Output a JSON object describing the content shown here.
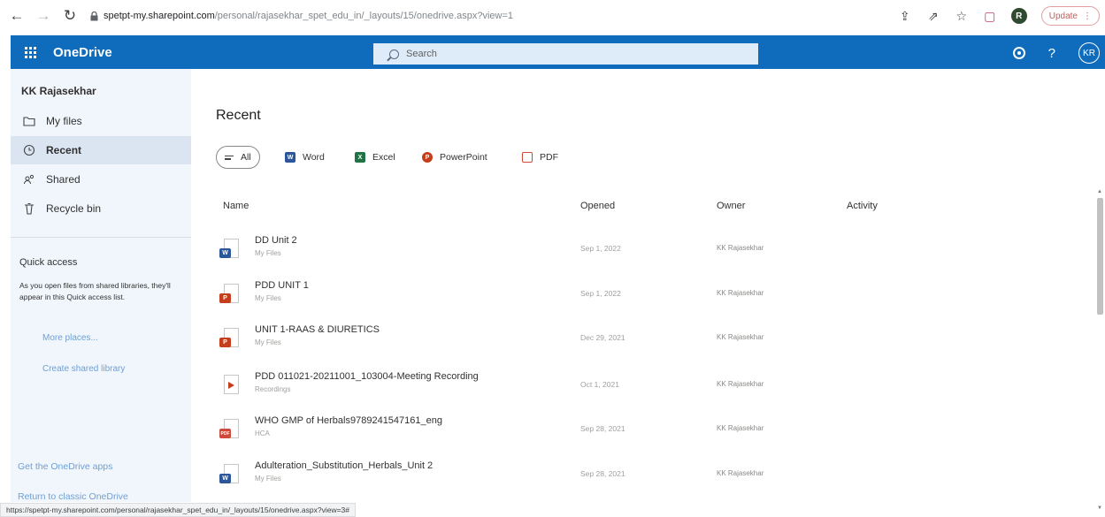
{
  "browser": {
    "url_host": "spetpt-my.sharepoint.com",
    "url_path": "/personal/rajasekhar_spet_edu_in/_layouts/15/onedrive.aspx?view=1",
    "update_label": "Update",
    "profile_initial": "R"
  },
  "suite": {
    "app_name": "OneDrive",
    "search_placeholder": "Search",
    "avatar_initials": "KR"
  },
  "nav": {
    "user_name": "KK Rajasekhar",
    "items": [
      {
        "label": "My files",
        "icon": "folder-icon"
      },
      {
        "label": "Recent",
        "icon": "clock-icon"
      },
      {
        "label": "Shared",
        "icon": "people-icon"
      },
      {
        "label": "Recycle bin",
        "icon": "recycle-bin-icon"
      }
    ],
    "quick_access_title": "Quick access",
    "quick_access_desc": "As you open files from shared libraries, they'll appear in this Quick access list.",
    "more_places": "More places...",
    "create_shared_library": "Create shared library",
    "get_apps": "Get the OneDrive apps",
    "return_classic": "Return to classic OneDrive"
  },
  "main": {
    "title": "Recent",
    "filters": [
      {
        "label": "All",
        "color": ""
      },
      {
        "label": "Word",
        "color": "#2b579a"
      },
      {
        "label": "Excel",
        "color": "#217346"
      },
      {
        "label": "PowerPoint",
        "color": "#c43e1c"
      },
      {
        "label": "PDF",
        "color": "#d04a3c"
      }
    ],
    "columns": {
      "name": "Name",
      "opened": "Opened",
      "owner": "Owner",
      "activity": "Activity"
    },
    "files": [
      {
        "name": "DD Unit 2",
        "location": "My Files",
        "opened": "Sep 1, 2022",
        "owner": "KK Rajasekhar",
        "type": "word"
      },
      {
        "name": "PDD UNIT 1",
        "location": "My Files",
        "opened": "Sep 1, 2022",
        "owner": "KK Rajasekhar",
        "type": "powerpoint"
      },
      {
        "name": "UNIT 1-RAAS & DIURETICS",
        "location": "My Files",
        "opened": "Dec 29, 2021",
        "owner": "KK Rajasekhar",
        "type": "powerpoint"
      },
      {
        "name": "PDD 011021-20211001_103004-Meeting Recording",
        "location": "Recordings",
        "opened": "Oct 1, 2021",
        "owner": "KK Rajasekhar",
        "type": "video"
      },
      {
        "name": "WHO GMP of Herbals9789241547161_eng",
        "location": "HCA",
        "opened": "Sep 28, 2021",
        "owner": "KK Rajasekhar",
        "type": "pdf"
      },
      {
        "name": "Adulteration_Substitution_Herbals_Unit 2",
        "location": "My Files",
        "opened": "Sep 28, 2021",
        "owner": "KK Rajasekhar",
        "type": "word"
      }
    ]
  },
  "status_url": "https://spetpt-my.sharepoint.com/personal/rajasekhar_spet_edu_in/_layouts/15/onedrive.aspx?view=3#"
}
